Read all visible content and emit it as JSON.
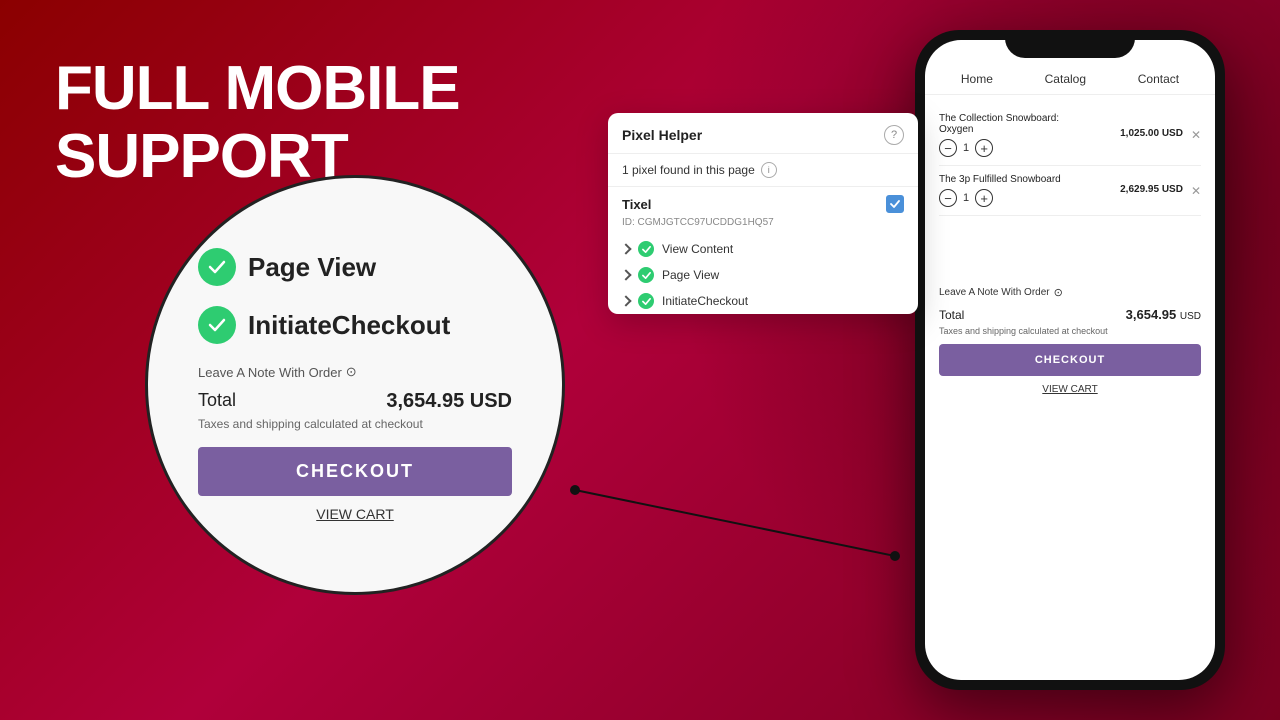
{
  "heading": {
    "line1": "FULL MOBILE",
    "line2": "SUPPORT"
  },
  "phone": {
    "nav": {
      "home": "Home",
      "catalog": "Catalog",
      "contact": "Contact"
    },
    "products": [
      {
        "name": "The Collection Snowboard: Oxygen",
        "qty": 1,
        "price": "1,025.00 USD"
      },
      {
        "name": "The 3p Fulfilled Snowboard",
        "qty": 1,
        "price": "2,629.95 USD"
      }
    ],
    "note_label": "Leave A Note With Order",
    "total_label": "Total",
    "total_amount": "3,654.95",
    "total_currency": "USD",
    "tax_note": "Taxes and shipping calculated at checkout",
    "checkout_label": "CHECKOUT",
    "viewcart_label": "VIEW CART"
  },
  "circle": {
    "badges": [
      {
        "label": "Page View"
      },
      {
        "label": "InitiateCheckout"
      }
    ],
    "note_label": "Leave A Note With Order",
    "total_label": "Total",
    "total_amount": "3,654.95 USD",
    "tax_note": "Taxes and shipping calculated at checkout",
    "checkout_label": "CHECKOUT",
    "viewcart_label": "VIEW CART"
  },
  "pixel_helper": {
    "title": "Pixel Helper",
    "help_icon": "?",
    "pixel_found": "1 pixel found in this page",
    "tixel_name": "Tixel",
    "tixel_id": "ID: CGMJGTCC97UCDDG1HQ57",
    "events": [
      {
        "label": "View Content"
      },
      {
        "label": "Page View"
      },
      {
        "label": "InitiateCheckout"
      }
    ]
  },
  "colors": {
    "background_start": "#8b0000",
    "background_end": "#7a0020",
    "checkout_button": "#7a5fa0",
    "green_check": "#2ecc71",
    "blue_check": "#4a90d9"
  }
}
